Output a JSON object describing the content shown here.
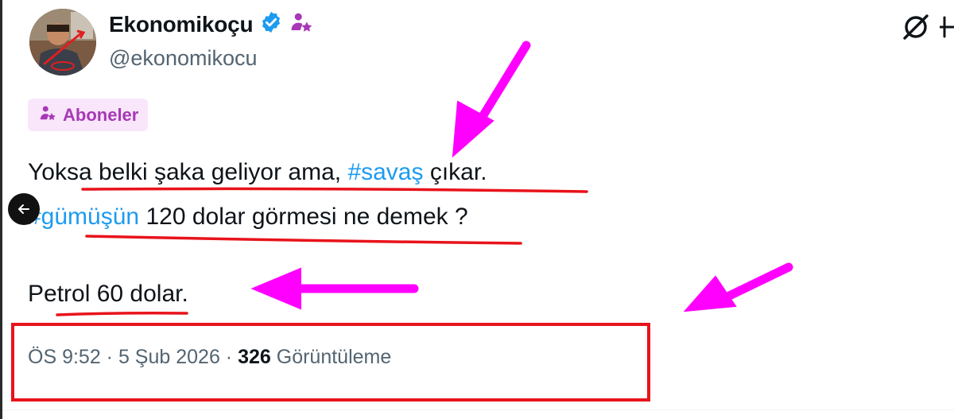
{
  "author": {
    "display_name": "Ekonomikoçu",
    "handle": "@ekonomikocu",
    "verified_icon": "verified-badge-icon",
    "subscriber_icon": "subscriber-star-icon"
  },
  "subscription_badge": {
    "label": "Aboneler",
    "icon": "person-star-icon"
  },
  "tweet": {
    "line1_before": "Yoksa belki şaka geliyor ama, ",
    "line1_hashtag": "#savaş",
    "line1_after": " çıkar.",
    "line2_hashtag": "#gümüşün",
    "line2_after": " 120 dolar görmesi ne demek ?",
    "line3": "Petrol 60 dolar."
  },
  "meta": {
    "time": "ÖS 9:52",
    "separator": " · ",
    "date": "5 Şub 2026",
    "views_count": "326",
    "views_label": " Görüntüleme"
  },
  "colors": {
    "hashtag": "#1d9bf0",
    "verified": "#1d9bf0",
    "subscriber": "#a738b6",
    "annotation_arrow": "#ff00ff",
    "annotation_underline": "#e8131b"
  },
  "icons": {
    "grok": "grok-icon",
    "more": "more-options-icon",
    "back": "back-arrow-icon"
  }
}
